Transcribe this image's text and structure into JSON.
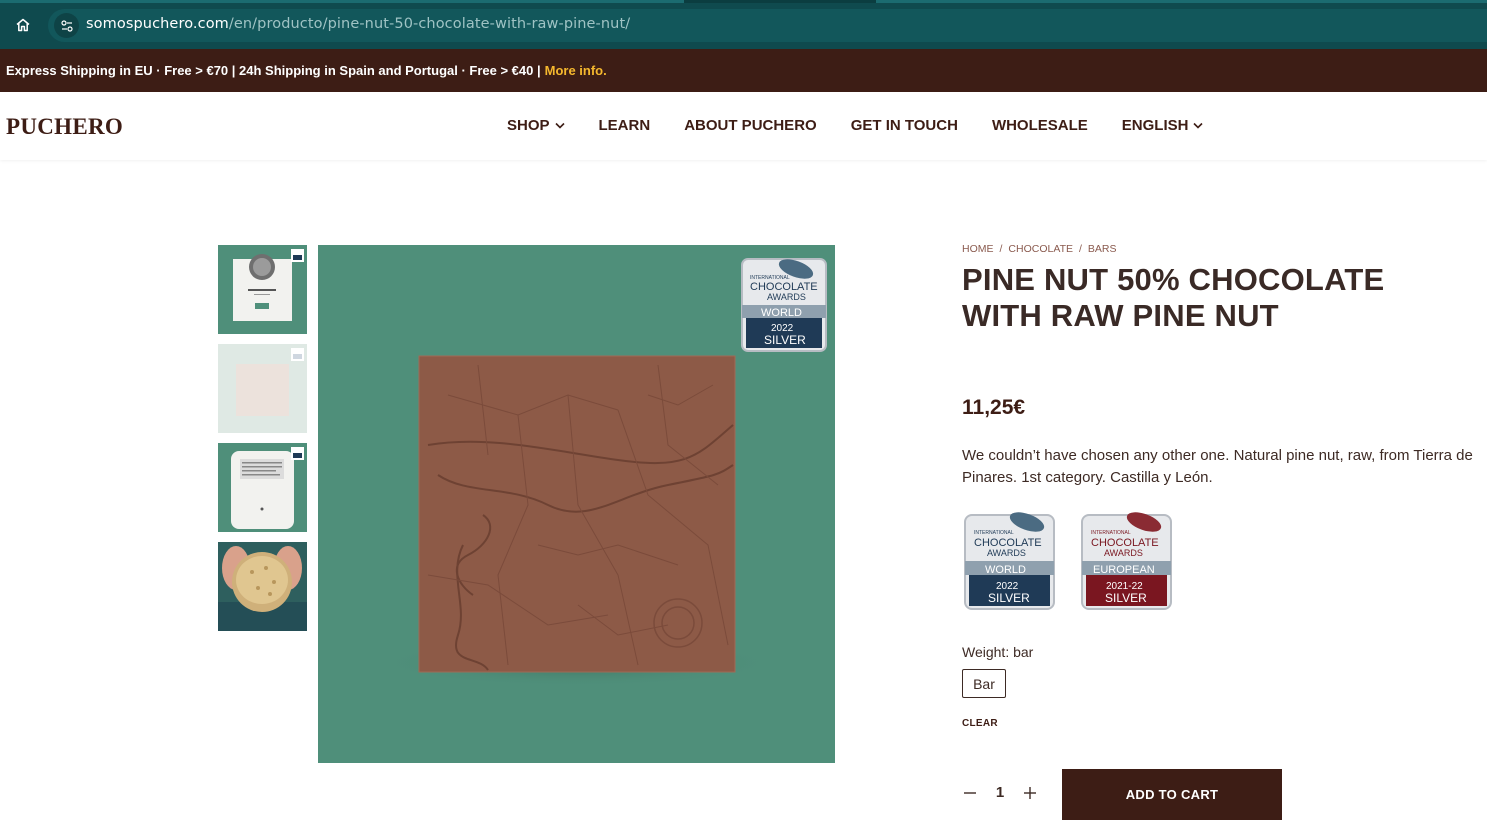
{
  "browser": {
    "url_host": "somospuchero.com",
    "url_path": "/en/producto/pine-nut-50-chocolate-with-raw-pine-nut/"
  },
  "announcement": {
    "text": "Express Shipping in EU · Free > €70 | 24h Shipping in Spain and Portugal · Free > €40 |",
    "link": "More info."
  },
  "header": {
    "logo": "PUCHERO",
    "nav": [
      {
        "label": "SHOP",
        "has_dropdown": true
      },
      {
        "label": "LEARN",
        "has_dropdown": false
      },
      {
        "label": "ABOUT PUCHERO",
        "has_dropdown": false
      },
      {
        "label": "GET IN TOUCH",
        "has_dropdown": false
      },
      {
        "label": "WHOLESALE",
        "has_dropdown": false
      },
      {
        "label": "ENGLISH",
        "has_dropdown": true
      }
    ]
  },
  "breadcrumb": [
    "HOME",
    "CHOCOLATE",
    "BARS"
  ],
  "product": {
    "title": "PINE NUT 50% CHOCOLATE WITH RAW PINE NUT",
    "price": "11,25€",
    "description": "We couldn’t have chosen any other one. Natural pine nut, raw, from Tierra de Pinares. 1st category. Castilla y León.",
    "weight_label": "Weight: bar",
    "variant": "Bar",
    "clear": "CLEAR",
    "quantity": "1",
    "add_to_cart": "ADD TO CART"
  },
  "awards": [
    {
      "top1": "INTERNATIONAL",
      "top2": "CHOCOLATE",
      "top3": "AWARDS",
      "band": "WORLD",
      "year": "2022",
      "medal": "SILVER",
      "color": "#1f3a56"
    },
    {
      "top1": "INTERNATIONAL",
      "top2": "CHOCOLATE",
      "top3": "AWARDS",
      "band": "EUROPEAN",
      "year": "2021-22",
      "medal": "SILVER",
      "color": "#7a1620"
    }
  ],
  "colors": {
    "brand": "#3d1d15",
    "accent": "#f5b82e",
    "product_bg": "#4f8f7a",
    "chocolate": "#8d5a47"
  }
}
